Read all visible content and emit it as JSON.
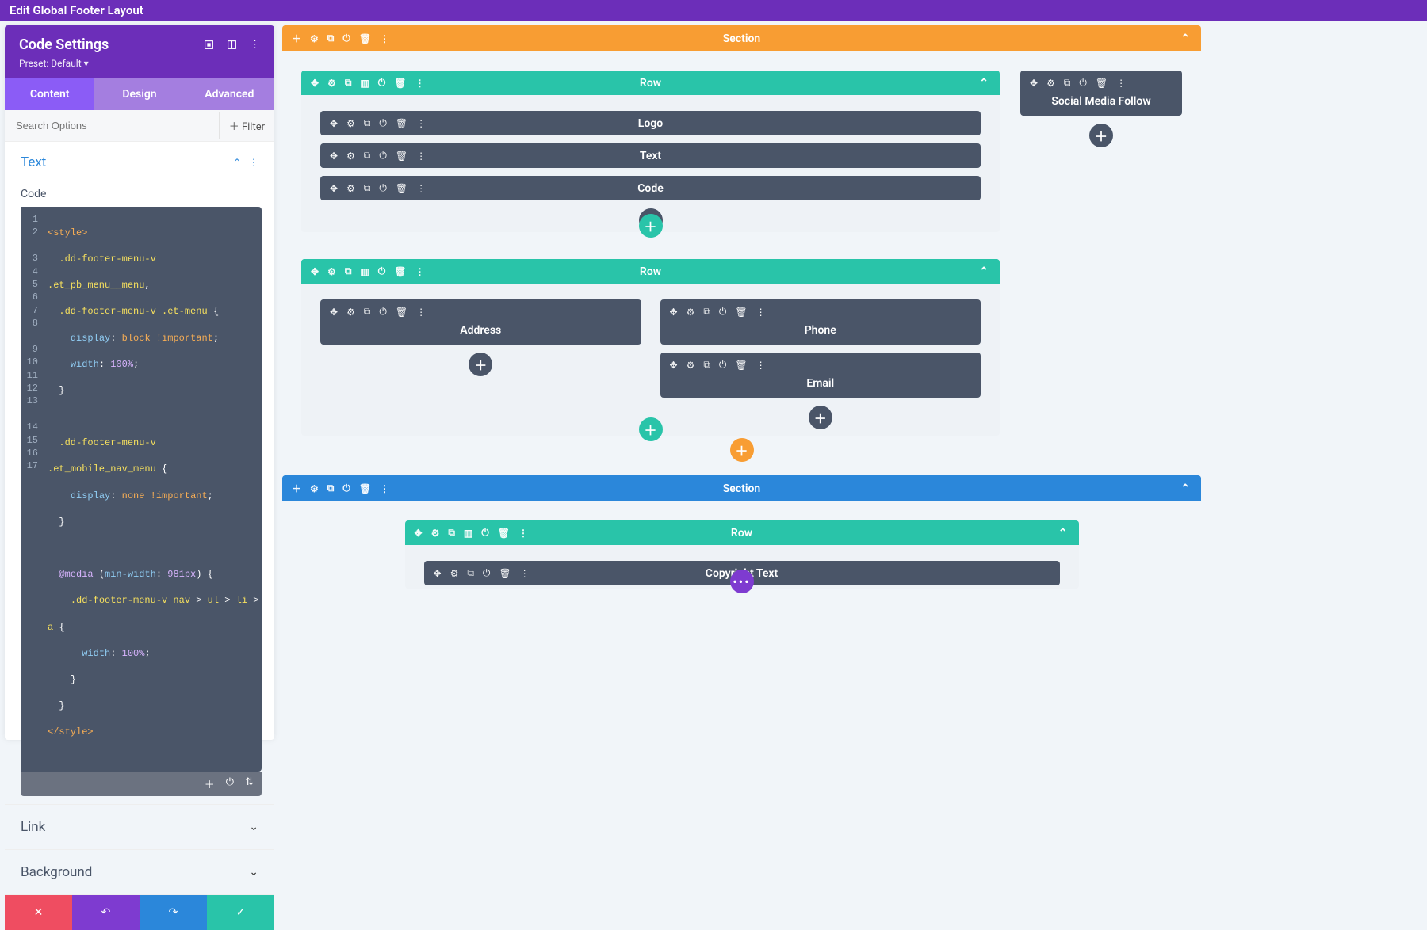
{
  "topbar": {
    "title": "Edit Global Footer Layout"
  },
  "panel": {
    "title": "Code Settings",
    "preset_label": "Preset: Default",
    "tabs": {
      "content": "Content",
      "design": "Design",
      "advanced": "Advanced"
    },
    "search_placeholder": "Search Options",
    "filter_label": "Filter",
    "text_section": "Text",
    "code_label": "Code",
    "code_lines": [
      "<style>",
      "  .dd-footer-menu-v .et_pb_menu__menu,",
      "  .dd-footer-menu-v .et-menu {",
      "    display: block !important;",
      "    width: 100%;",
      "  }",
      "",
      "  .dd-footer-menu-v .et_mobile_nav_menu {",
      "    display: none !important;",
      "  }",
      "",
      "  @media (min-width: 981px) {",
      "    .dd-footer-menu-v nav > ul > li > a {",
      "      width: 100%;",
      "    }",
      "  }",
      "</style>"
    ],
    "link_section": "Link",
    "background_section": "Background"
  },
  "canvas": {
    "section1": {
      "label": "Section",
      "row1": {
        "label": "Row",
        "modules": {
          "logo": "Logo",
          "text": "Text",
          "code": "Code"
        }
      },
      "sideModule": "Social Media Follow",
      "row2": {
        "label": "Row",
        "modules": {
          "address": "Address",
          "phone": "Phone",
          "email": "Email"
        }
      }
    },
    "section2": {
      "label": "Section",
      "row1": {
        "label": "Row",
        "module": "Copyright Text"
      }
    }
  }
}
